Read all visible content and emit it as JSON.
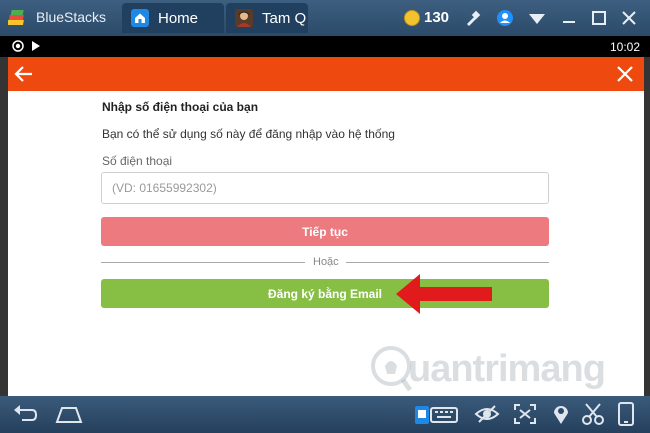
{
  "window": {
    "app_name": "BlueStacks",
    "tabs": [
      {
        "label": "Home",
        "icon": "home-icon"
      },
      {
        "label": "Tam Quốc",
        "icon": "game-avatar-icon"
      }
    ],
    "coins": "130",
    "icons": [
      "coin-icon",
      "wrench-icon",
      "user-icon",
      "wifi-icon",
      "minimize-icon",
      "maximize-icon",
      "close-icon"
    ]
  },
  "statusbar": {
    "time": "10:02"
  },
  "appbar": {
    "color": "#ee4a10",
    "icons": [
      "back-arrow-icon",
      "close-x-icon"
    ]
  },
  "form": {
    "heading": "Nhập số điện thoại của bạn",
    "subtitle": "Bạn có thể sử dụng số này để đăng nhập vào hệ thống",
    "phone_label": "Số điện thoại",
    "phone_placeholder": "(VD: 01655992302)",
    "phone_value": "",
    "continue_label": "Tiếp tục",
    "or_label": "Hoặc",
    "email_label": "Đăng ký bằng Email"
  },
  "colors": {
    "continue": "#ec7a7e",
    "email": "#87bf45",
    "arrow": "#e11b1b"
  },
  "watermark": {
    "text": "uantrimang",
    "icon": "lightbulb-icon"
  },
  "navbar": {
    "icons": [
      "nav-back-icon",
      "nav-home-icon",
      "keyboard-icon",
      "eye-icon",
      "fullscreen-icon",
      "location-icon",
      "scissors-icon",
      "phone-rotate-icon"
    ]
  }
}
